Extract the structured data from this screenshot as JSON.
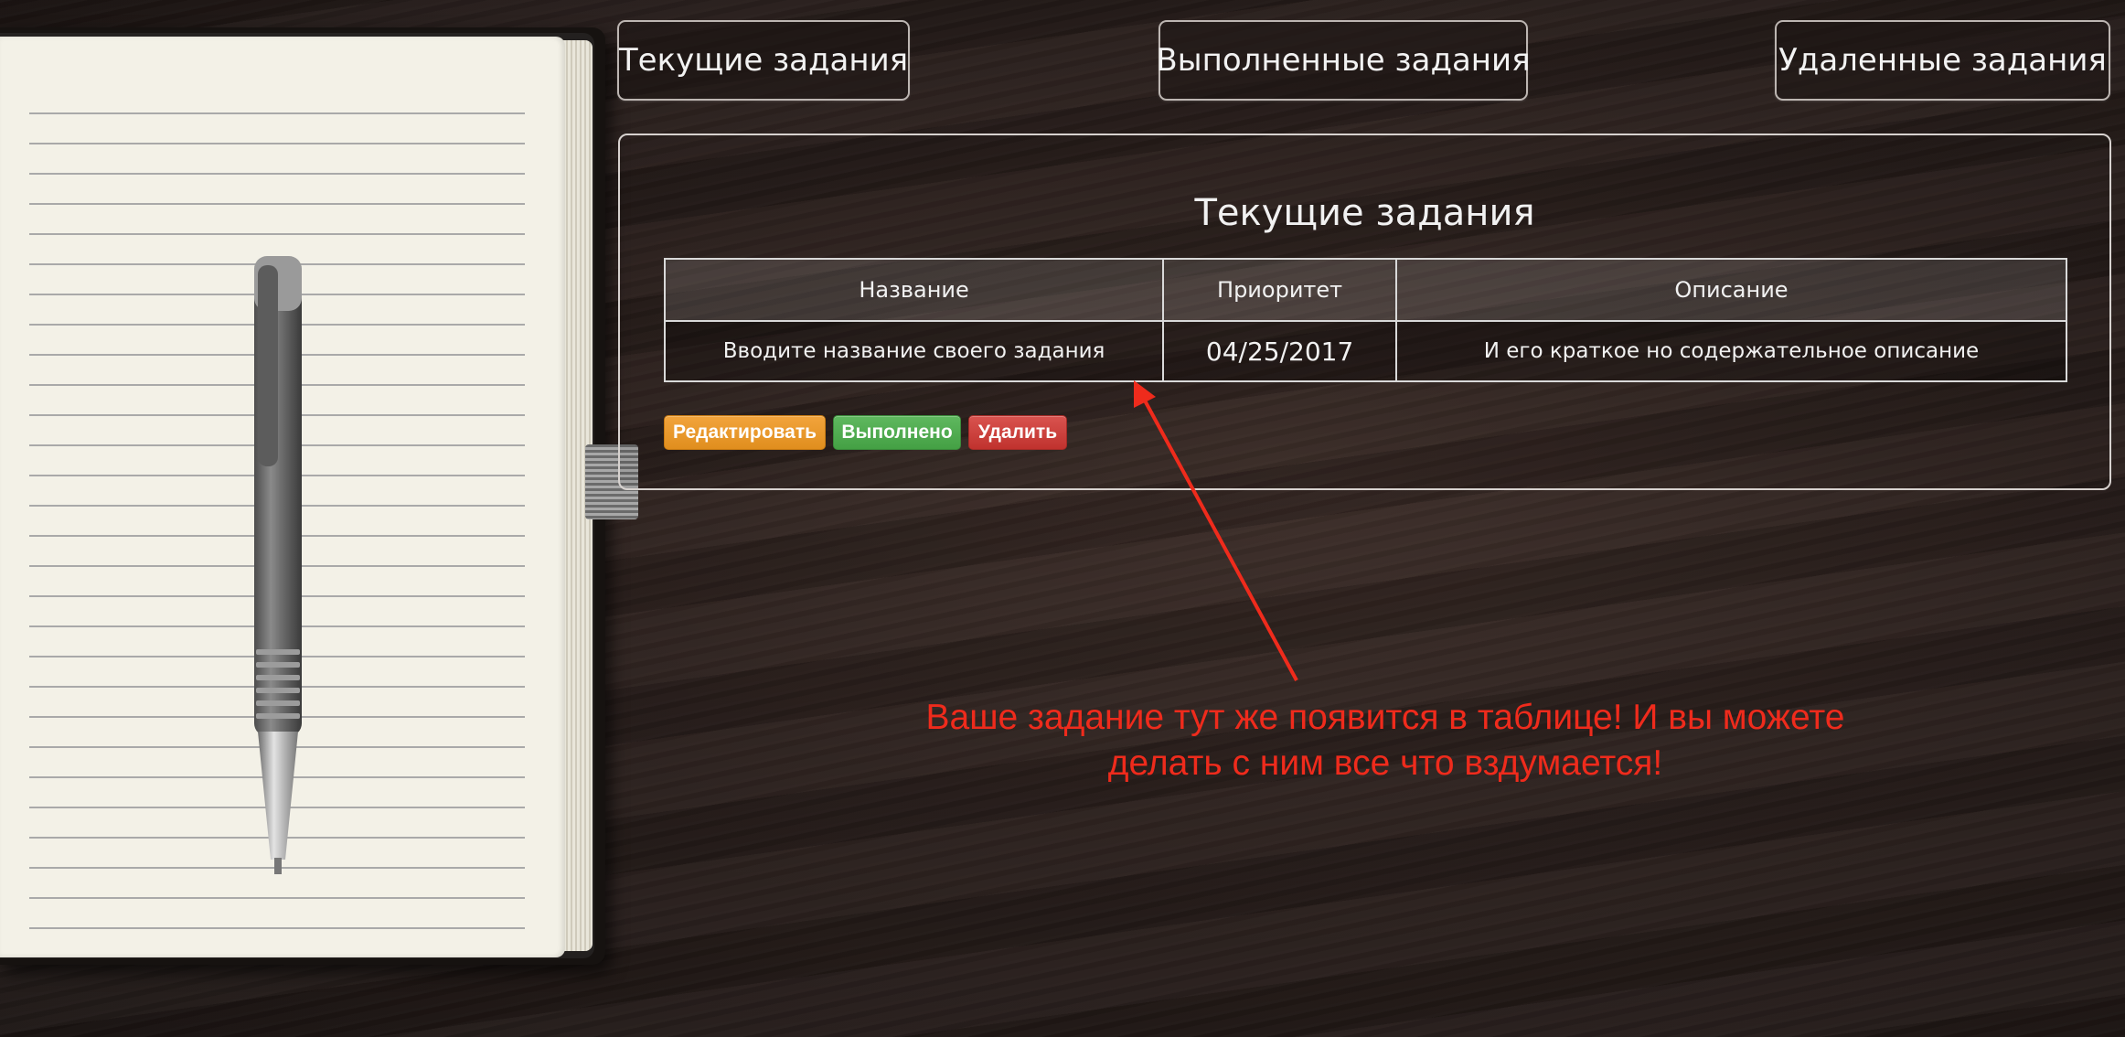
{
  "nav": {
    "current_tasks": "Текущие задания",
    "completed_tasks": "Выполненные задания",
    "deleted_tasks": "Удаленные задания"
  },
  "panel": {
    "title": "Текущие задания",
    "table": {
      "headers": [
        "Название",
        "Приоритет",
        "Описание"
      ],
      "rows": [
        [
          "Вводите название своего задания",
          "04/25/2017",
          "И его краткое но содержательное описание"
        ]
      ]
    },
    "actions": {
      "edit": "Редактировать",
      "done": "Выполнено",
      "delete": "Удалить"
    }
  },
  "annotation": {
    "line1": "Ваше задание тут же появится в таблице! И вы можете",
    "line2": "делать с ним все что вздумается!"
  },
  "colors": {
    "edit": "#f0a030",
    "done": "#4cae4c",
    "delete": "#d43f3a",
    "annotation": "#ef2b1c"
  }
}
